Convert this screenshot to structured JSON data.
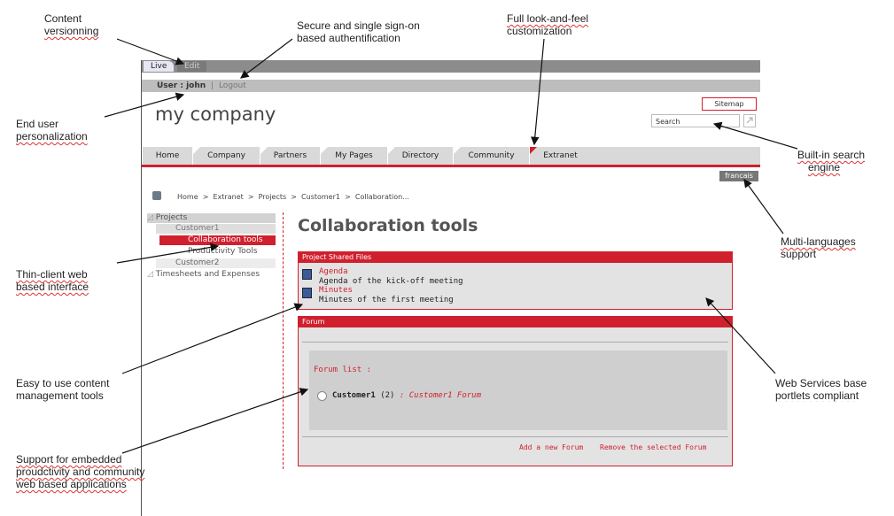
{
  "annotations": {
    "content_versioning": [
      "Content",
      "versionning"
    ],
    "secure_sso": [
      "Secure and single sign-on",
      "based authentification"
    ],
    "look_and_feel": [
      "Full look-and-feel",
      "customization"
    ],
    "end_user": [
      "End user",
      "personalization"
    ],
    "search_engine": [
      "Built-in search",
      "engine"
    ],
    "multi_lang": [
      "Multi-languages",
      "support"
    ],
    "thin_client": [
      "Thin-client web",
      "based interface"
    ],
    "cms_tools": [
      "Easy to use content",
      "management tools"
    ],
    "web_services": [
      "Web Services base",
      "portlets compliant"
    ],
    "embedded_apps": [
      "Support for embedded",
      "proudctivity and community",
      "web based applications"
    ]
  },
  "tabs": {
    "live": "Live",
    "edit": "Edit"
  },
  "userbar": {
    "user": "User : john",
    "separator": "|",
    "logout": "Logout"
  },
  "header": {
    "company": "my company",
    "sitemap": "Sitemap",
    "search_value": "Search"
  },
  "nav": [
    "Home",
    "Company",
    "Partners",
    "My Pages",
    "Directory",
    "Community",
    "Extranet"
  ],
  "nav_active_index": 6,
  "language": "francais",
  "breadcrumb": "Home  >  Extranet  >  Projects  >  Customer1  >  Collaboration...",
  "sidebar": {
    "projects": "Projects",
    "customer1": "Customer1",
    "collab": "Collaboration tools",
    "productivity": "Productivity Tools",
    "customer2": "Customer2",
    "timesheets": "Timesheets and Expenses"
  },
  "page_title": "Collaboration tools",
  "files_portlet": {
    "title": "Project Shared Files",
    "items": [
      {
        "name": "Agenda",
        "desc": "Agenda of the kick-off meeting"
      },
      {
        "name": "Minutes",
        "desc": "Minutes of the first meeting"
      }
    ]
  },
  "forum_portlet": {
    "title": "Forum",
    "list_label": "Forum list :",
    "forum_name": "Customer1",
    "forum_count": "(2)",
    "forum_desc": ": Customer1 Forum",
    "add": "Add a new Forum",
    "remove": "Remove the selected Forum"
  },
  "colors": {
    "accent": "#d0202e",
    "bar": "#8c8c8c",
    "panel": "#e3e3e3"
  }
}
